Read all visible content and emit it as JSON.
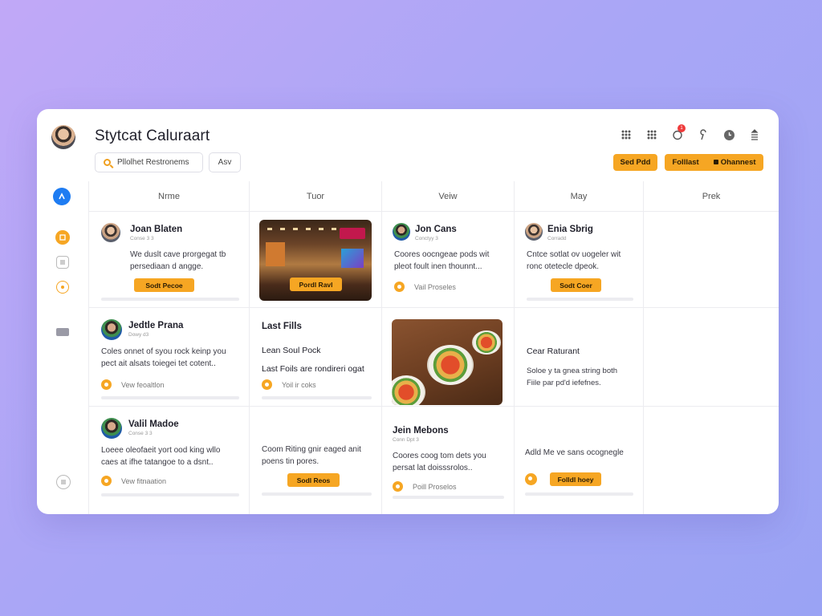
{
  "app": {
    "title": "Stytcat Caluraart",
    "search_placeholder": "Pllolhet Restronems",
    "asv_label": "Asv",
    "send_label": "Sed Pdd",
    "folllast_label": "Folllast",
    "ohanest_label": "Ohannest",
    "notification_count": "1"
  },
  "columns": [
    "Nrme",
    "Tuor",
    "Veiw",
    "May",
    "Prek"
  ],
  "cards": {
    "c1": {
      "name": "Joan Blaten",
      "sub": "Conse 3 3",
      "text": "We duslt cave prorgegat tb persediaan d angge.",
      "button": "Sodt Pecoe"
    },
    "c2": {
      "button": "Pordl Ravl"
    },
    "c3": {
      "name": "Jon Cans",
      "sub": "Conctyy 3",
      "text": "Coores oocngeae pods wit pleot foult inen thounnt...",
      "link": "Vail Proseles"
    },
    "c4": {
      "name": "Enia Sbrig",
      "sub": "Corradd",
      "text": "Cntce sotlat ov uogeler wit ronc otetecle dpeok.",
      "button": "Sodt Coer"
    },
    "c5": {
      "name": "Jedtle Prana",
      "sub": "Dowy d3",
      "text": "Coles onnet of syou rock keinp you pect ait alsats toiegei tet cotent..",
      "link": "Vew feoaltlon"
    },
    "c6": {
      "title": "Last Fills",
      "line1": "Lean Soul Pock",
      "line2": "Last Foils are rondireri ogat",
      "link": "Yoil ir coks"
    },
    "c7": {
      "title": "Cear Raturant",
      "text": "Soloe y ta gnea string both Fiile par pd'd iefefnes."
    },
    "c8": {
      "name": "Valil Madoe",
      "sub": "Conse 3 3",
      "text": "Loeee oleofaeit yort ood king wllo caes at ifhe tatangoe to a dsnt..",
      "link": "Vew fitnaation"
    },
    "c9": {
      "text": "Coom Riting gnir eaged anit poens tin pores.",
      "button": "Sodl Reos"
    },
    "c10": {
      "name": "Jein Mebons",
      "sub": "Conn Dpt 3",
      "text": "Coores coog tom dets you persat lat doisssrolos..",
      "link": "Poill Proselos"
    },
    "c11": {
      "text": "Adld Me ve sans ocognegle",
      "button": "Folldl hoey"
    }
  },
  "icons": {
    "accent": "#f6a623",
    "sidebar_active": "#1e7cf2"
  }
}
